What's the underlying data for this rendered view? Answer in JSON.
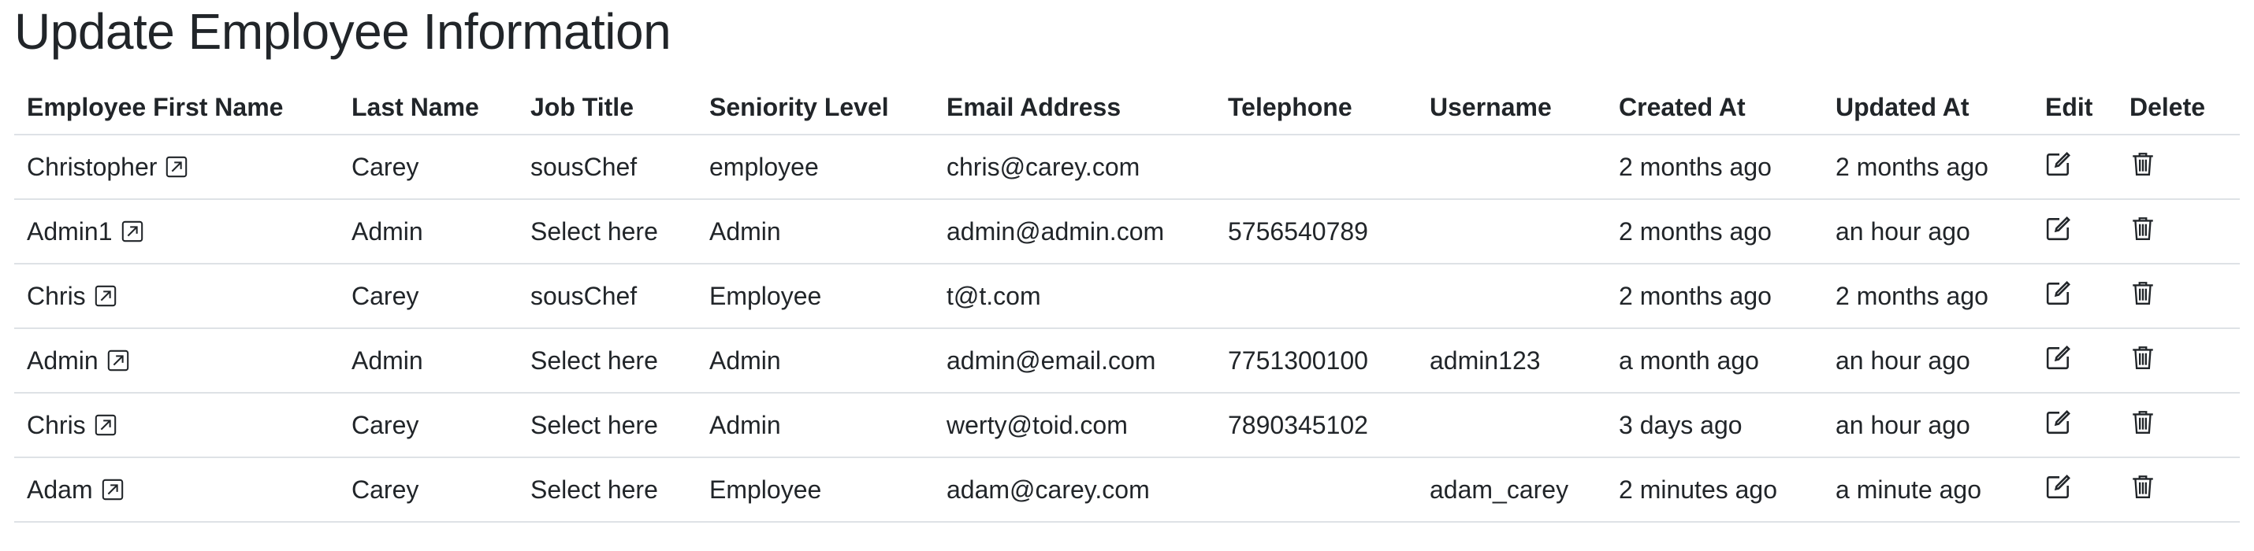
{
  "title": "Update Employee Information",
  "columns": [
    "Employee First Name",
    "Last Name",
    "Job Title",
    "Seniority Level",
    "Email Address",
    "Telephone",
    "Username",
    "Created At",
    "Updated At",
    "Edit",
    "Delete"
  ],
  "rows": [
    {
      "first_name": "Christopher",
      "last_name": "Carey",
      "job_title": "sousChef",
      "seniority": "employee",
      "email": "chris@carey.com",
      "telephone": "",
      "username": "",
      "created_at": "2 months ago",
      "updated_at": "2 months ago"
    },
    {
      "first_name": "Admin1",
      "last_name": "Admin",
      "job_title": "Select here",
      "seniority": "Admin",
      "email": "admin@admin.com",
      "telephone": "5756540789",
      "username": "",
      "created_at": "2 months ago",
      "updated_at": "an hour ago"
    },
    {
      "first_name": "Chris",
      "last_name": "Carey",
      "job_title": "sousChef",
      "seniority": "Employee",
      "email": "t@t.com",
      "telephone": "",
      "username": "",
      "created_at": "2 months ago",
      "updated_at": "2 months ago"
    },
    {
      "first_name": "Admin",
      "last_name": "Admin",
      "job_title": "Select here",
      "seniority": "Admin",
      "email": "admin@email.com",
      "telephone": "7751300100",
      "username": "admin123",
      "created_at": "a month ago",
      "updated_at": "an hour ago"
    },
    {
      "first_name": "Chris",
      "last_name": "Carey",
      "job_title": "Select here",
      "seniority": "Admin",
      "email": "werty@toid.com",
      "telephone": "7890345102",
      "username": "",
      "created_at": "3 days ago",
      "updated_at": "an hour ago"
    },
    {
      "first_name": "Adam",
      "last_name": "Carey",
      "job_title": "Select here",
      "seniority": "Employee",
      "email": "adam@carey.com",
      "telephone": "",
      "username": "adam_carey",
      "created_at": "2 minutes ago",
      "updated_at": "a minute ago"
    }
  ],
  "icons": {
    "link": "external-link-icon",
    "edit": "edit-icon",
    "delete": "trash-icon"
  }
}
